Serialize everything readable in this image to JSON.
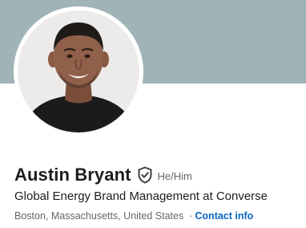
{
  "profile": {
    "name": "Austin Bryant",
    "verified_icon": "shield-check-icon",
    "pronouns": "He/Him",
    "headline": "Global Energy Brand Management at Converse",
    "location": "Boston, Massachusetts, United States",
    "separator": "·",
    "contact_link": "Contact info"
  },
  "colors": {
    "banner": "#a0b3b7",
    "link": "#0a66c2",
    "text_primary": "#1d1d1d",
    "text_secondary": "#666666"
  }
}
